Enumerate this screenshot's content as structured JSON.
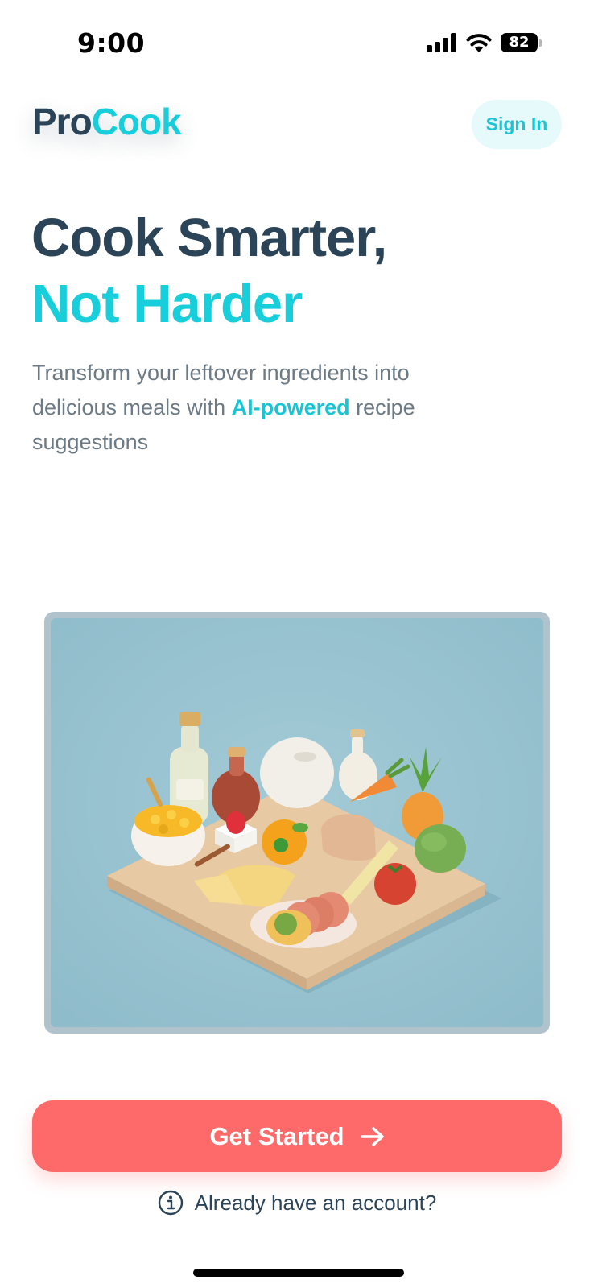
{
  "status_bar": {
    "time": "9:00",
    "battery": "82",
    "icons": [
      "signal-icon",
      "wifi-icon",
      "battery-icon"
    ]
  },
  "header": {
    "logo_part1": "Pro",
    "logo_part2": "Cook",
    "sign_in_label": "Sign In"
  },
  "hero": {
    "headline_line1": "Cook Smarter,",
    "headline_line2": "Not Harder",
    "subtitle_before": "Transform your leftover ingredients into delicious meals with ",
    "subtitle_highlight": "AI-powered",
    "subtitle_after": " recipe suggestions"
  },
  "actions": {
    "get_started_label": "Get Started",
    "account_prompt": "Already have an account?"
  },
  "colors": {
    "brand_dark": "#2c4457",
    "brand_accent": "#19cedb",
    "cta": "#fe6a6a",
    "image_bg": "#97c2d0"
  }
}
